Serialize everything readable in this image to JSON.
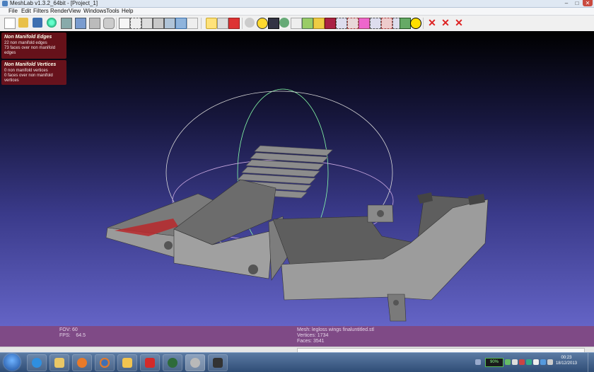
{
  "window": {
    "title": "MeshLab v1.3.2_64bit - [Project_1]",
    "controls": [
      "–",
      "□",
      "✕"
    ]
  },
  "menu": [
    "File",
    "Edit",
    "Filters",
    "Render",
    "View",
    "Windows",
    "Tools",
    "Help"
  ],
  "toolbar_icons": [
    "new-project-icon",
    "open-icon",
    "save-icon",
    "reload-icon",
    "snapshot-icon",
    "layers-icon",
    "print-icon",
    "bbox-icon",
    "points-icon",
    "wireframe-icon",
    "hidden-lines-icon",
    "flat-lines-icon",
    "flat-icon",
    "smooth-icon",
    "lighting-icon",
    "double-side-icon",
    "fancy-light-icon",
    "manipulator-icon",
    "annotate-icon",
    "select-faces-icon",
    "measure-icon",
    "align-icon",
    "paint-icon",
    "pick-points-icon",
    "select-connected-icon",
    "select-verts-icon",
    "quality-icon",
    "raster-icon",
    "info-icon",
    "delete-faces-icon",
    "delete-verts-icon",
    "clear-icon"
  ],
  "info_boxes": {
    "edges": {
      "title": "Non Manifold Edges",
      "line1": "22 non manifold edges",
      "line2": "73 faces over non manifold edges"
    },
    "vertices": {
      "title": "Non Manifold Vertices",
      "line1": "0 non manifold vertices",
      "line2": "0 faces over non manifold vertices"
    }
  },
  "status": {
    "fov": "FOV: 60",
    "fps": "FPS:    64.5",
    "mesh": "Mesh: legloss wings finaluntitled.stl",
    "vertices": "Vertices: 1734",
    "faces": "Faces: 3541"
  },
  "taskbar": {
    "apps": [
      "ie-icon",
      "explorer-icon",
      "media-player-icon",
      "firefox-icon",
      "folder-icon",
      "pdf-icon",
      "sketchup-icon",
      "meshlab-icon",
      "camera-icon"
    ],
    "battery": "90%",
    "time": "00:23",
    "date": "18/12/2013"
  },
  "colors": {
    "viewport_top": "#000000",
    "viewport_bottom": "#6464c6",
    "info_box_bg": "#78141c",
    "statusbar_bg": "#7f4a86",
    "mesh_face": "#8c8c8c",
    "mesh_nonmanifold": "#b8282c"
  }
}
